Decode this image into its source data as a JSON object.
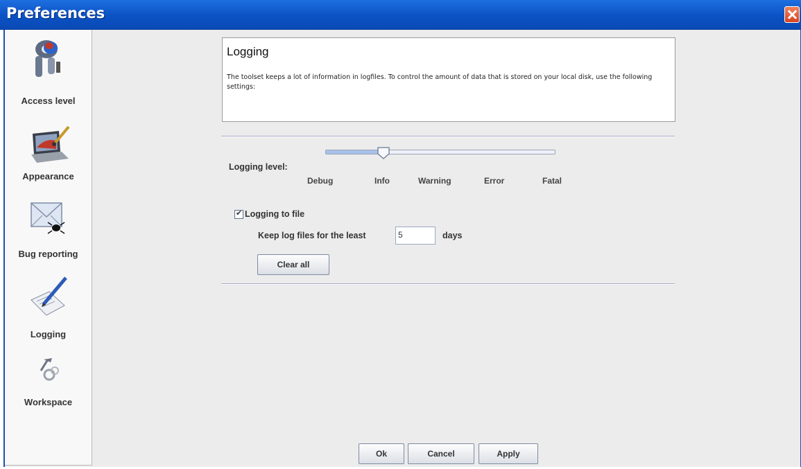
{
  "window": {
    "title": "Preferences"
  },
  "sidebar": {
    "items": [
      {
        "label": "Access level",
        "icon": "keys-icon"
      },
      {
        "label": "Appearance",
        "icon": "laptop-paint-icon"
      },
      {
        "label": "Bug reporting",
        "icon": "envelope-bug-icon"
      },
      {
        "label": "Logging",
        "icon": "notepad-pencil-icon"
      },
      {
        "label": "Workspace",
        "icon": "tools-gear-icon"
      }
    ]
  },
  "panel": {
    "title": "Logging",
    "description": "The toolset keeps a lot of information in logfiles. To control the amount of data that is stored on your local disk, use the following settings:"
  },
  "logging_level": {
    "label": "Logging level:",
    "options": [
      "Debug",
      "Info",
      "Warning",
      "Error",
      "Fatal"
    ],
    "selected": "Info",
    "selected_index": 1
  },
  "log_to_file": {
    "label": "Logging to file",
    "checked": true
  },
  "keep_files": {
    "label": "Keep log files for the least",
    "value": "5",
    "unit": "days"
  },
  "buttons": {
    "clear_all": "Clear all",
    "ok": "Ok",
    "cancel": "Cancel",
    "apply": "Apply"
  },
  "colors": {
    "titlebar": "#0b52c4",
    "close": "#d8401e",
    "panel_bg": "#ececec"
  }
}
